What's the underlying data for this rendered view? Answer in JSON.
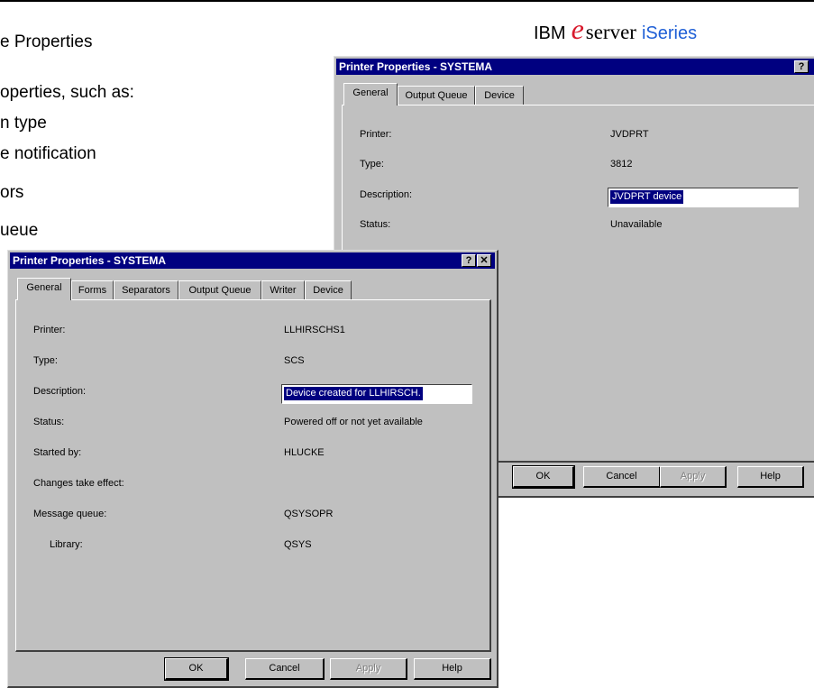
{
  "logo": {
    "ibm": "IBM",
    "e": "e",
    "server": "server",
    "iseries": "iSeries"
  },
  "slide": {
    "lines": [
      "e Properties",
      "operties, such as:",
      "n type",
      "e notification",
      "ors",
      "ueue"
    ]
  },
  "dialog_back": {
    "title": "Printer Properties - SYSTEMA",
    "title_buttons": {
      "help": "?",
      "close": "✕"
    },
    "tabs": [
      "General",
      "Output Queue",
      "Device"
    ],
    "fields": [
      {
        "label": "Printer:",
        "value": "JVDPRT"
      },
      {
        "label": "Type:",
        "value": "3812"
      },
      {
        "label": "Description:",
        "value": "JVDPRT device"
      },
      {
        "label": "Status:",
        "value": "Unavailable"
      }
    ],
    "buttons": {
      "ok": "OK",
      "cancel": "Cancel",
      "apply": "Apply",
      "help": "Help"
    }
  },
  "dialog_front": {
    "title": "Printer Properties - SYSTEMA",
    "title_buttons": {
      "help": "?",
      "close": "✕"
    },
    "tabs": [
      "General",
      "Forms",
      "Separators",
      "Output Queue",
      "Writer",
      "Device"
    ],
    "fields": [
      {
        "label": "Printer:",
        "value": "LLHIRSCHS1"
      },
      {
        "label": "Type:",
        "value": "SCS"
      },
      {
        "label": "Description:",
        "value": "Device created for LLHIRSCH."
      },
      {
        "label": "Status:",
        "value": "Powered off or not yet available"
      },
      {
        "label": "Started by:",
        "value": "HLUCKE"
      },
      {
        "label": "Changes take effect:",
        "value": ""
      },
      {
        "label": "Message queue:",
        "value": "QSYSOPR"
      },
      {
        "label": "Library:",
        "value": "QSYS"
      }
    ],
    "buttons": {
      "ok": "OK",
      "cancel": "Cancel",
      "apply": "Apply",
      "help": "Help"
    }
  }
}
